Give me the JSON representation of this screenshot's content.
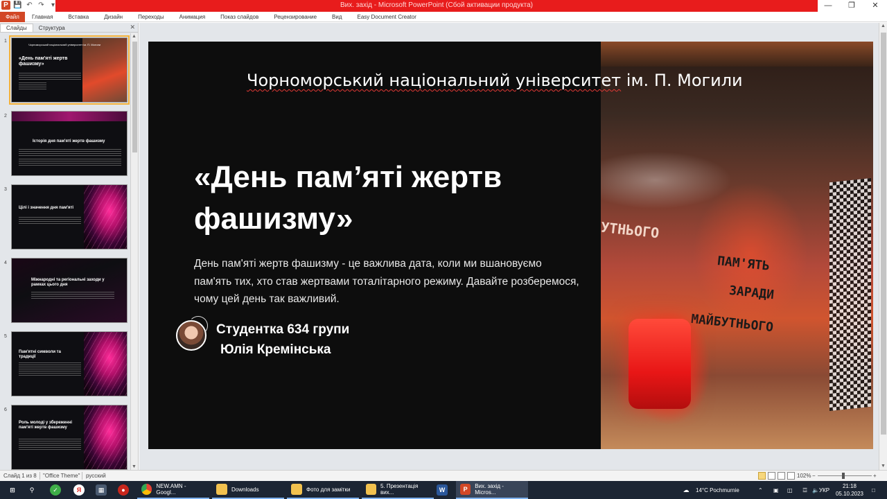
{
  "window": {
    "title": "Вих. захід - Microsoft PowerPoint (Сбой активации продукта)",
    "accent": "#e81c1c"
  },
  "ribbon": {
    "tabs": [
      "Файл",
      "Главная",
      "Вставка",
      "Дизайн",
      "Переходы",
      "Анимация",
      "Показ слайдов",
      "Рецензирование",
      "Вид",
      "Easy Document Creator"
    ]
  },
  "left_pane": {
    "tabs": [
      "Слайды",
      "Структура"
    ],
    "slides": [
      {
        "num": "1",
        "title": "«День пам'яті жертв фашизму»",
        "header": "Чорноморський національний університет ім. П. Могили"
      },
      {
        "num": "2",
        "title": "Історія дня пам'яті жертв фашизму"
      },
      {
        "num": "3",
        "title": "Цілі і значення дня пам'яті"
      },
      {
        "num": "4",
        "title": "Міжнародні та регіональні заходи у рамках цього дня"
      },
      {
        "num": "5",
        "title": "Пам'ятні символи та традиції"
      },
      {
        "num": "6",
        "title": "Роль молоді у збереженні пам'яті жертв фашизму"
      }
    ]
  },
  "slide": {
    "university": {
      "part1": "Чорноморський національний університет",
      "part2": "ім. П. Могили"
    },
    "heading_line1": "«День пам’яті жертв",
    "heading_line2": "фашизму»",
    "body": "День пам'яті жертв фашизму - це важлива дата, коли ми вшановуємо пам'ять тих, хто став жертвами тоталітарного режиму. Давайте розберемося, чому цей день так важливий.",
    "author_line1": "Студентка 634 групи",
    "author_line2": "Юлія Кремінська",
    "photo_text": {
      "a": "УТНЬОГО",
      "b": "ПАМ'ЯТЬ",
      "c": "ЗАРАДИ",
      "d": "МАЙБУТНЬОГО"
    }
  },
  "statusbar": {
    "slide_info": "Слайд 1 из 8",
    "theme": "\"Office Theme\"",
    "language": "русский",
    "zoom": "102%"
  },
  "taskbar": {
    "apps": [
      "NEW.AMN - Googl...",
      "Downloads",
      "Фото для замітки",
      "5. Презентація вих...",
      "Вих. захід - Micros..."
    ],
    "weather": "14°C  Pochmurnie",
    "lang": "УКР",
    "time": "21:18",
    "date": "05.10.2023"
  }
}
